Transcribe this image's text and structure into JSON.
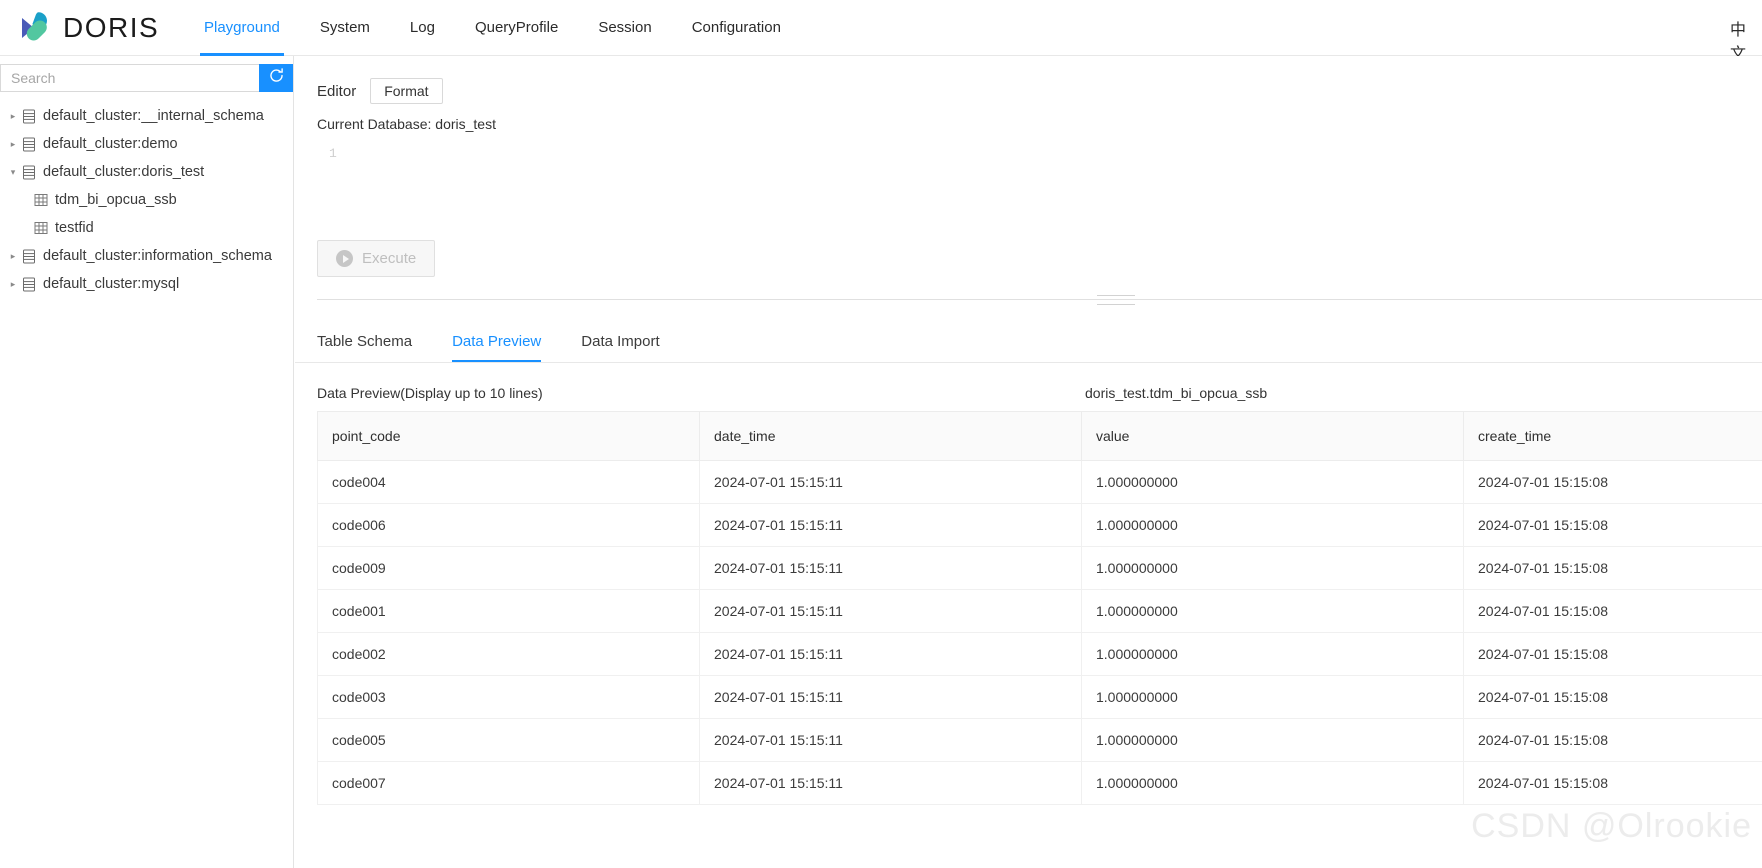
{
  "header": {
    "brand": "DORIS",
    "logo_icon": "doris-logo",
    "nav": [
      {
        "label": "Playground",
        "active": true
      },
      {
        "label": "System",
        "active": false
      },
      {
        "label": "Log",
        "active": false
      },
      {
        "label": "QueryProfile",
        "active": false
      },
      {
        "label": "Session",
        "active": false
      },
      {
        "label": "Configuration",
        "active": false
      }
    ],
    "lang_toggle": "中文",
    "accent_color": "#1890ff"
  },
  "sidebar": {
    "search": {
      "value": "",
      "placeholder": "Search"
    },
    "refresh_icon": "refresh-icon",
    "tree": [
      {
        "label": "default_cluster:__internal_schema",
        "type": "database",
        "expanded": false,
        "caret": "▸"
      },
      {
        "label": "default_cluster:demo",
        "type": "database",
        "expanded": false,
        "caret": "▸"
      },
      {
        "label": "default_cluster:doris_test",
        "type": "database",
        "expanded": true,
        "caret": "▾"
      },
      {
        "label": "tdm_bi_opcua_ssb",
        "type": "table",
        "expanded": false,
        "caret": ""
      },
      {
        "label": "testfid",
        "type": "table",
        "expanded": false,
        "caret": ""
      },
      {
        "label": "default_cluster:information_schema",
        "type": "database",
        "expanded": false,
        "caret": "▸"
      },
      {
        "label": "default_cluster:mysql",
        "type": "database",
        "expanded": false,
        "caret": "▸"
      }
    ]
  },
  "editor": {
    "label": "Editor",
    "format_button": "Format",
    "current_database": "Current Database: doris_test",
    "line_number": "1",
    "sql_value": "",
    "execute_button": "Execute",
    "execute_icon": "play-icon",
    "execute_disabled": true
  },
  "result": {
    "tabs": [
      {
        "label": "Table Schema",
        "active": false
      },
      {
        "label": "Data Preview",
        "active": true
      },
      {
        "label": "Data Import",
        "active": false
      }
    ],
    "preview_title": "Data Preview(Display up to 10 lines)",
    "table_name": "doris_test.tdm_bi_opcua_ssb",
    "columns": [
      "point_code",
      "date_time",
      "value",
      "create_time"
    ],
    "rows": [
      [
        "code004",
        "2024-07-01 15:15:11",
        "1.000000000",
        "2024-07-01 15:15:08"
      ],
      [
        "code006",
        "2024-07-01 15:15:11",
        "1.000000000",
        "2024-07-01 15:15:08"
      ],
      [
        "code009",
        "2024-07-01 15:15:11",
        "1.000000000",
        "2024-07-01 15:15:08"
      ],
      [
        "code001",
        "2024-07-01 15:15:11",
        "1.000000000",
        "2024-07-01 15:15:08"
      ],
      [
        "code002",
        "2024-07-01 15:15:11",
        "1.000000000",
        "2024-07-01 15:15:08"
      ],
      [
        "code003",
        "2024-07-01 15:15:11",
        "1.000000000",
        "2024-07-01 15:15:08"
      ],
      [
        "code005",
        "2024-07-01 15:15:11",
        "1.000000000",
        "2024-07-01 15:15:08"
      ],
      [
        "code007",
        "2024-07-01 15:15:11",
        "1.000000000",
        "2024-07-01 15:15:08"
      ]
    ]
  },
  "watermark": "CSDN @Olrookie"
}
